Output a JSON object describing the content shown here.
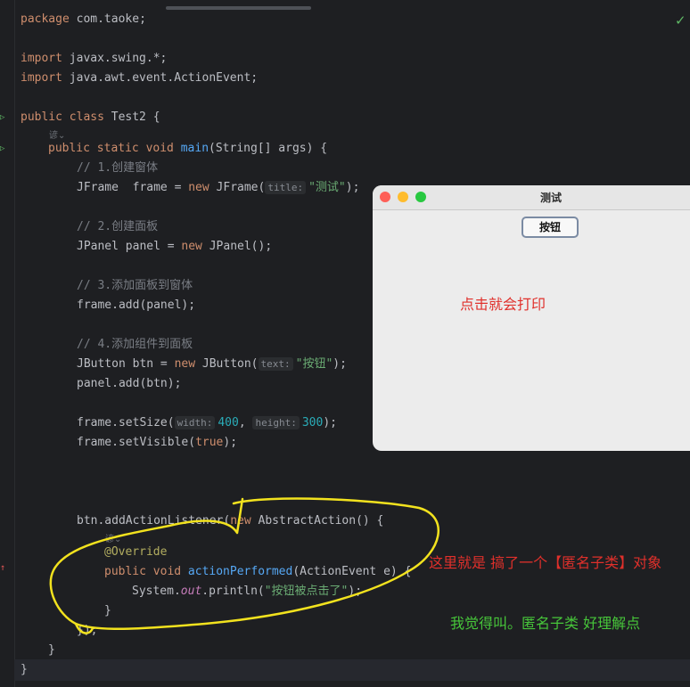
{
  "editor": {
    "lines": {
      "l1": {
        "kw": "package",
        "rest": " com.taoke;"
      },
      "l2": {
        "kw": "import",
        "rest": " javax.swing.*;"
      },
      "l3": {
        "kw": "import",
        "rest": " java.awt.event.ActionEvent;"
      },
      "l4": {
        "kw": "public class",
        "rest": " Test2 {"
      },
      "l5": {
        "kw": "public static void",
        "fn": "main",
        "rest": "(String[] args) {"
      },
      "c1": "// 1.创建窗体",
      "l6": {
        "a": "JFrame  frame = ",
        "kw": "new",
        "b": " JFrame(",
        "hint": "title:",
        "str": "\"测试\"",
        "c": ");"
      },
      "c2": "// 2.创建面板",
      "l7": {
        "a": "JPanel panel = ",
        "kw": "new",
        "b": " JPanel();"
      },
      "c3": "// 3.添加面板到窗体",
      "l8": "frame.add(panel);",
      "c4": "// 4.添加组件到面板",
      "l9": {
        "a": "JButton btn = ",
        "kw": "new",
        "b": " JButton(",
        "hint": "text:",
        "str": "\"按钮\"",
        "c": ");"
      },
      "l10": "panel.add(btn);",
      "l11": {
        "a": "frame.setSize(",
        "hint1": "width:",
        "n1": "400",
        "b": ", ",
        "hint2": "height:",
        "n2": "300",
        "c": ");"
      },
      "l12": {
        "a": "frame.setVisible(",
        "kw": "true",
        "b": ");"
      },
      "l13": {
        "a": "btn.addActionListener(",
        "kw": "new",
        "b": " AbstractAction() {"
      },
      "l14": "@Override",
      "l15": {
        "kw": "public void",
        "fn": "actionPerformed",
        "rest": "(ActionEvent e) {"
      },
      "l16": {
        "a": "System.",
        "st": "out",
        "b": ".println(",
        "str": "\"按钮被点击了\"",
        "c": ");"
      },
      "l17": "}",
      "l18": "});",
      "l19": "}",
      "l20": "}"
    },
    "codelens_label": "谚⌄"
  },
  "window": {
    "title": "测试",
    "button_label": "按钮",
    "colors": {
      "close": "#fe5f57",
      "minimize": "#febc2e",
      "zoom": "#28c840"
    }
  },
  "annotations": {
    "click_note": "点击就会打印",
    "anon_note": "这里就是 搞了一个【匿名子类】对象",
    "opinion_note": "我觉得叫。匿名子类 好理解点"
  }
}
